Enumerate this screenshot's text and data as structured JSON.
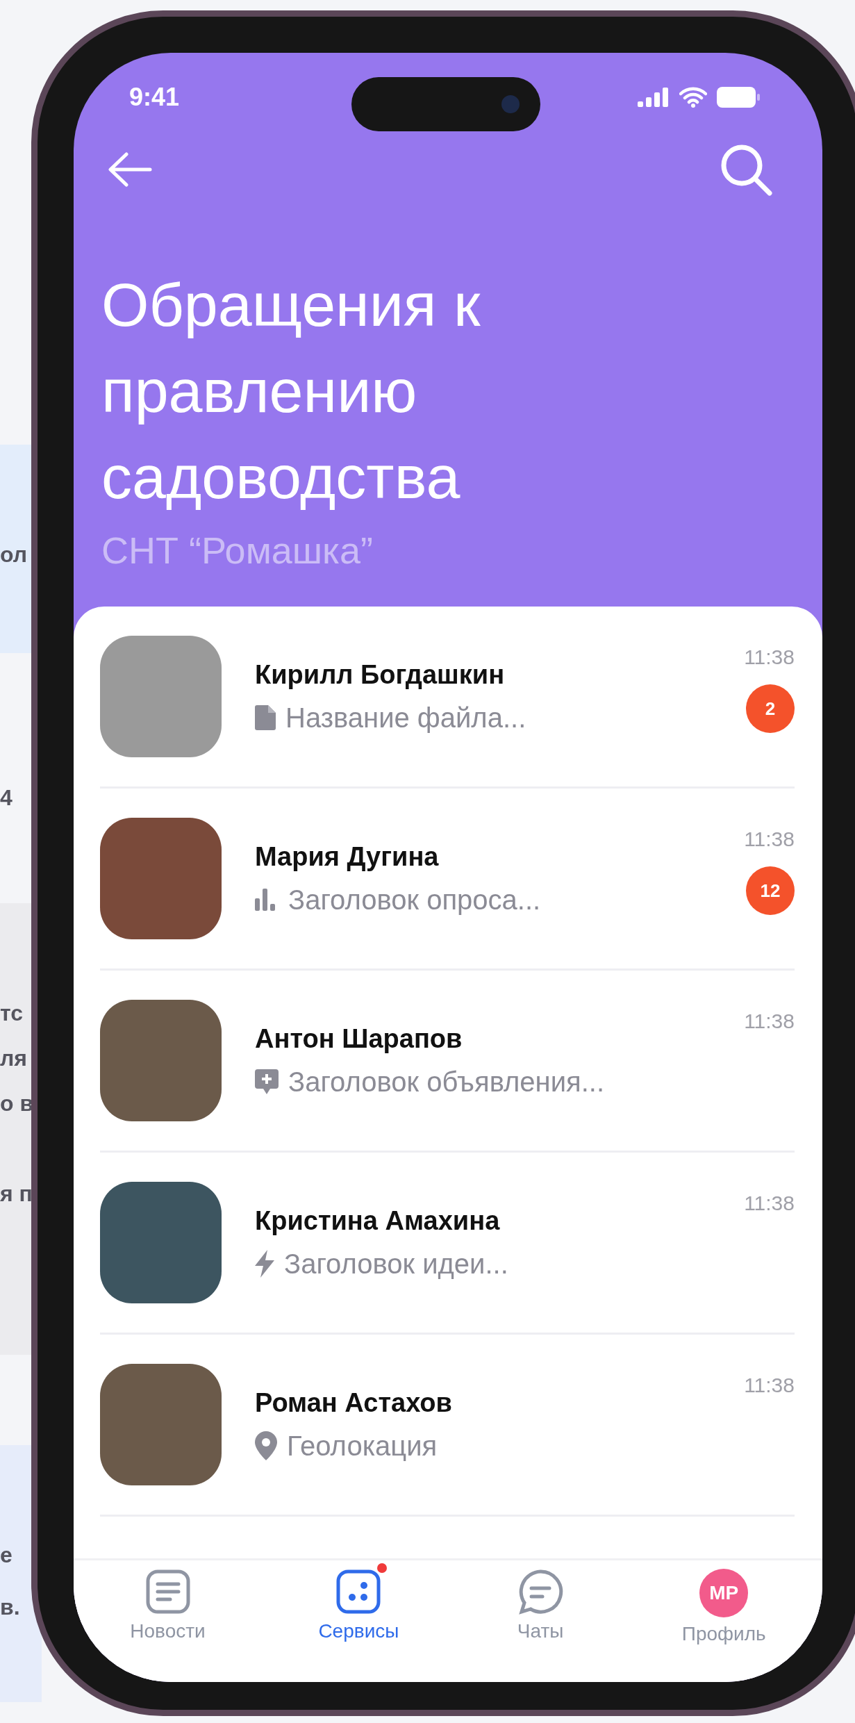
{
  "backdrop": {
    "fragments": [
      "ол",
      "4",
      "тс",
      "ля",
      "о в",
      "я п",
      "е",
      "в."
    ]
  },
  "status_bar": {
    "time": "9:41"
  },
  "header": {
    "title": "Обращения к правлению садоводства",
    "subtitle": "СНТ “Ромашка”"
  },
  "chats": [
    {
      "name": "Кирилл Богдашкин",
      "kind": "file",
      "preview": "Название файла...",
      "time": "11:38",
      "unread": "2"
    },
    {
      "name": "Мария Дугина",
      "kind": "poll",
      "preview": "Заголовок опроса...",
      "time": "11:38",
      "unread": "12"
    },
    {
      "name": "Антон Шарапов",
      "kind": "announcement",
      "preview": "Заголовок объявления...",
      "time": "11:38"
    },
    {
      "name": "Кристина Амахина",
      "kind": "idea",
      "preview": "Заголовок идеи...",
      "time": "11:38"
    },
    {
      "name": "Роман Астахов",
      "kind": "location",
      "preview": "Геолокация",
      "time": "11:38"
    }
  ],
  "nav": [
    {
      "label": "Новости",
      "kind": "news",
      "selected": false,
      "notification": false
    },
    {
      "label": "Сервисы",
      "kind": "services",
      "selected": true,
      "notification": true
    },
    {
      "label": "Чаты",
      "kind": "chats",
      "selected": false,
      "notification": false
    },
    {
      "label": "Профиль",
      "kind": "profile",
      "selected": false,
      "notification": false,
      "initials": "МР"
    }
  ]
}
